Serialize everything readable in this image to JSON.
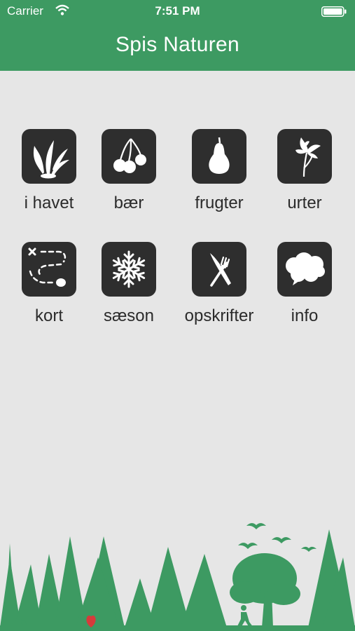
{
  "status": {
    "carrier": "Carrier",
    "time": "7:51 PM"
  },
  "nav": {
    "title": "Spis Naturen"
  },
  "tiles": [
    {
      "label": "i havet",
      "icon": "seaweed-icon"
    },
    {
      "label": "bær",
      "icon": "berries-icon"
    },
    {
      "label": "frugter",
      "icon": "pear-icon"
    },
    {
      "label": "urter",
      "icon": "flower-icon"
    },
    {
      "label": "kort",
      "icon": "map-icon"
    },
    {
      "label": "sæson",
      "icon": "snowflake-icon"
    },
    {
      "label": "opskrifter",
      "icon": "fork-knife-icon"
    },
    {
      "label": "info",
      "icon": "speech-bubble-icon"
    }
  ],
  "colors": {
    "header": "#3d9a62",
    "background": "#e6e6e6",
    "tile": "#2e2e2e",
    "forest": "#3d9a62"
  }
}
